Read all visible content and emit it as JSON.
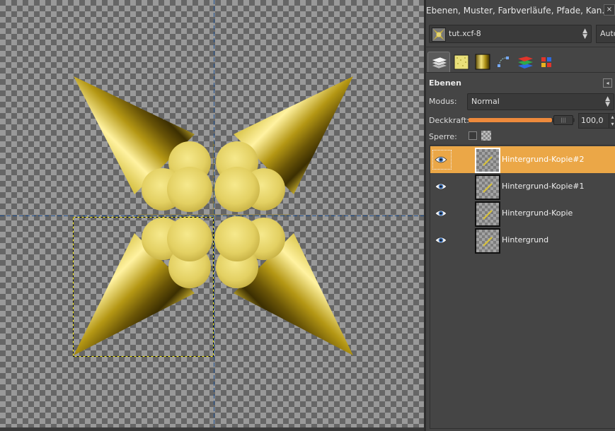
{
  "dock": {
    "title": "Ebenen, Muster, Farbverläufe, Pfade, Kan...",
    "close_glyph": "×",
    "image_selector": {
      "value": "tut.xcf-8"
    },
    "auto_button": "Auto",
    "tabs": [
      {
        "name": "layers-tab",
        "icon": "layers-icon",
        "active": true
      },
      {
        "name": "patterns-tab",
        "icon": "pattern-icon",
        "active": false
      },
      {
        "name": "gradients-tab",
        "icon": "gradient-icon",
        "active": false
      },
      {
        "name": "paths-tab",
        "icon": "paths-icon",
        "active": false
      },
      {
        "name": "channels-tab",
        "icon": "channels-icon",
        "active": false
      },
      {
        "name": "colormap-tab",
        "icon": "colormap-icon",
        "active": false
      }
    ]
  },
  "layers_panel": {
    "title": "Ebenen",
    "menu_glyph": "◂",
    "mode_label": "Modus:",
    "mode_value": "Normal",
    "opacity_label": "Deckkraft:",
    "opacity_value": "100,0",
    "opacity_fraction": 1.0,
    "lock_label": "Sperre:",
    "layers": [
      {
        "name": "Hintergrund-Kopie#2",
        "visible": true,
        "selected": true
      },
      {
        "name": "Hintergrund-Kopie#1",
        "visible": true,
        "selected": false
      },
      {
        "name": "Hintergrund-Kopie",
        "visible": true,
        "selected": false
      },
      {
        "name": "Hintergrund",
        "visible": true,
        "selected": false
      }
    ]
  },
  "colors": {
    "accent": "#eba747",
    "slider": "#ee8a3c",
    "gold_light": "#f2e27a",
    "gold_dark": "#5c4a05"
  }
}
